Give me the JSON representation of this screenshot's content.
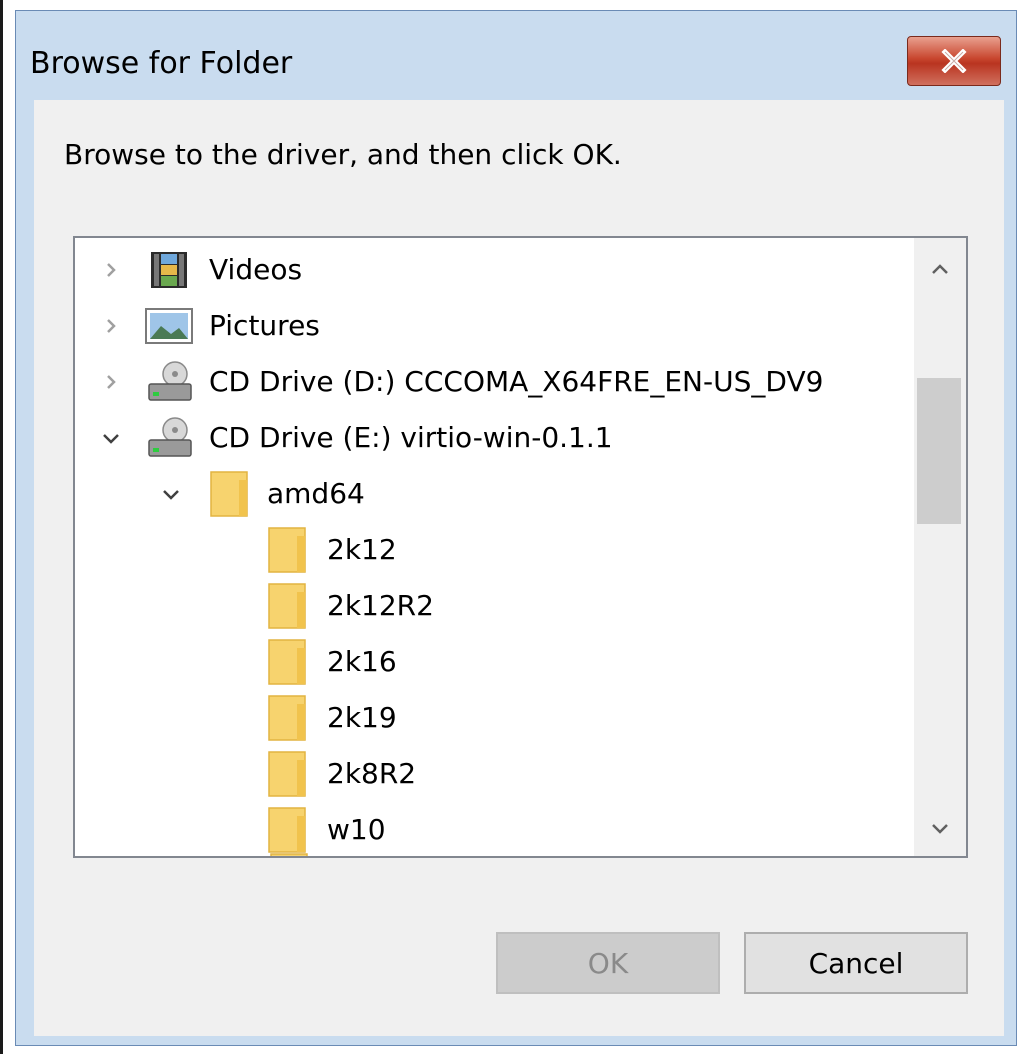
{
  "window": {
    "title": "Browse for Folder"
  },
  "instruction": "Browse to the driver, and then click OK.",
  "tree": {
    "items": [
      {
        "label": "Videos",
        "icon": "videos-icon",
        "expander": "collapsed"
      },
      {
        "label": "Pictures",
        "icon": "pictures-icon",
        "expander": "collapsed"
      },
      {
        "label": "CD Drive (D:) CCCOMA_X64FRE_EN-US_DV9",
        "icon": "cd-drive-icon",
        "expander": "collapsed"
      },
      {
        "label": "CD Drive (E:) virtio-win-0.1.1",
        "icon": "cd-drive-icon",
        "expander": "expanded"
      },
      {
        "label": "amd64",
        "icon": "folder-icon",
        "expander": "expanded"
      },
      {
        "label": "2k12",
        "icon": "folder-icon",
        "expander": "none"
      },
      {
        "label": "2k12R2",
        "icon": "folder-icon",
        "expander": "none"
      },
      {
        "label": "2k16",
        "icon": "folder-icon",
        "expander": "none"
      },
      {
        "label": "2k19",
        "icon": "folder-icon",
        "expander": "none"
      },
      {
        "label": "2k8R2",
        "icon": "folder-icon",
        "expander": "none"
      },
      {
        "label": "w10",
        "icon": "folder-icon",
        "expander": "none"
      }
    ]
  },
  "buttons": {
    "ok": "OK",
    "cancel": "Cancel"
  },
  "colors": {
    "folder": "#f7d36e",
    "close_button": "#c8462e",
    "title_bar": "#c9dcef"
  }
}
